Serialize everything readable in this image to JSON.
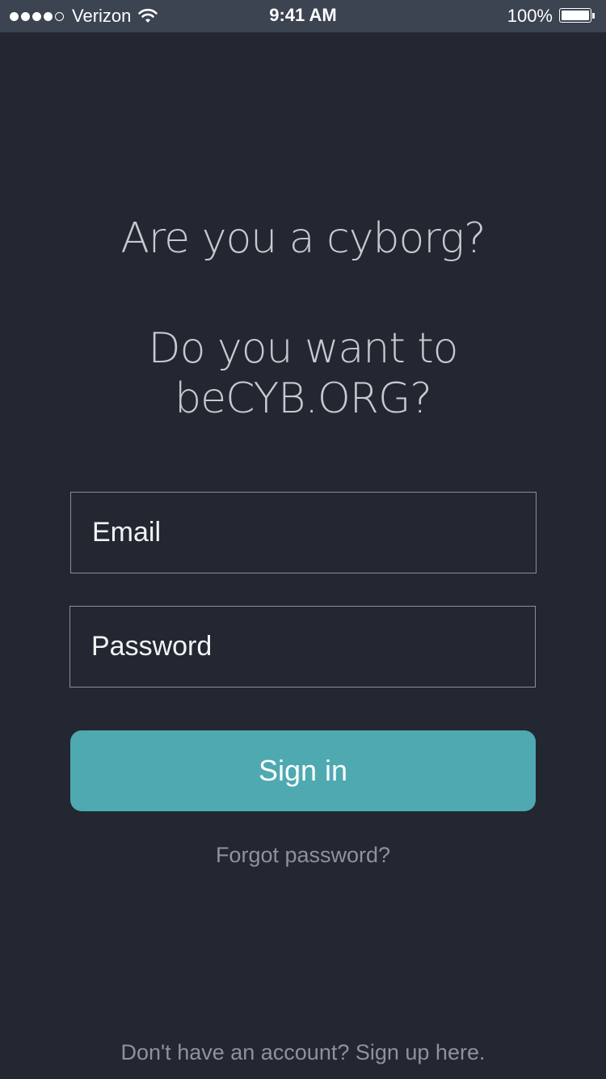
{
  "status_bar": {
    "carrier": "Verizon",
    "time": "9:41 AM",
    "battery": "100%",
    "signal_bars_filled": 4,
    "signal_bars_total": 5,
    "battery_level": 1.0
  },
  "headline": {
    "line1": "Are you a cyborg?",
    "line2": "Do you want to beCYB.ORG?"
  },
  "form": {
    "email_placeholder": "Email",
    "password_placeholder": "Password",
    "signin_label": "Sign in",
    "forgot_label": "Forgot password?"
  },
  "footer": {
    "signup_label": "Don't have an account? Sign up here."
  },
  "colors": {
    "background": "#232731",
    "status_bar": "#3c4452",
    "accent": "#4ea9b1",
    "muted_text": "#8d929b"
  },
  "icons": [
    "signal-icon",
    "wifi-icon",
    "battery-icon"
  ]
}
